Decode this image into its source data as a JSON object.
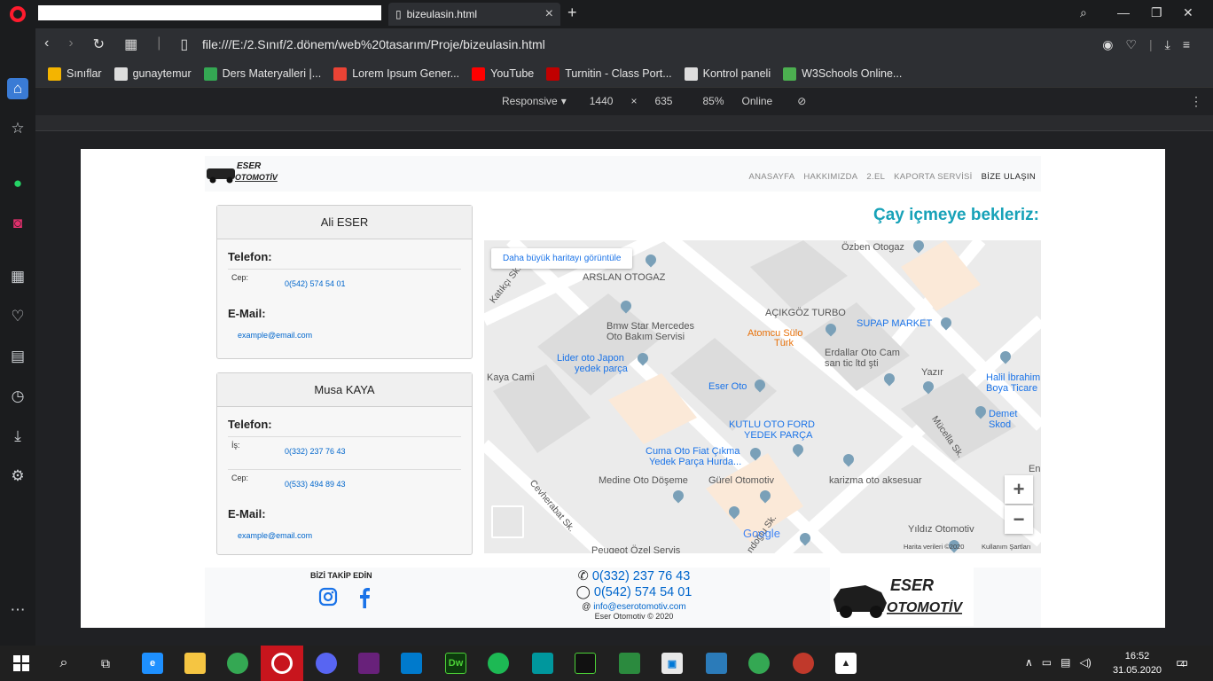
{
  "browser": {
    "tab_title": "bizeulasin.html",
    "address": "file:///E:/2.Sınıf/2.dönem/web%20tasarım/Proje/bizeulasin.html",
    "bookmarks": [
      {
        "label": "Sınıflar",
        "color": "#f4b400"
      },
      {
        "label": "gunaytemur",
        "color": "#dddddd"
      },
      {
        "label": "Ders Materyalleri |...",
        "color": "#34a853"
      },
      {
        "label": "Lorem Ipsum Gener...",
        "color": "#ea4335"
      },
      {
        "label": "YouTube",
        "color": "#ff0000"
      },
      {
        "label": "Turnitin - Class Port...",
        "color": "#c00000"
      },
      {
        "label": "Kontrol paneli",
        "color": "#dddddd"
      },
      {
        "label": "W3Schools Online...",
        "color": "#4caf50"
      }
    ],
    "devtools": {
      "mode": "Responsive",
      "width": "1440",
      "times": "×",
      "height": "635",
      "zoom": "85%",
      "throttle": "Online"
    }
  },
  "site": {
    "nav": {
      "items": [
        "ANASAYFA",
        "HAKKIMIZDA",
        "2.EL",
        "KAPORTA SERVİSİ",
        "BİZE ULAŞIN"
      ],
      "active": "BİZE ULAŞIN"
    },
    "logo_text_1": "ESER",
    "logo_text_2": "OTOMOTİV",
    "cards": [
      {
        "name": "Ali ESER",
        "phone_label": "Telefon:",
        "phones": [
          {
            "type": "Cep:",
            "number": "0(542) 574 54 01"
          }
        ],
        "mail_label": "E-Mail:",
        "mail": "example@email.com"
      },
      {
        "name": "Musa KAYA",
        "phone_label": "Telefon:",
        "phones": [
          {
            "type": "İş:",
            "number": "0(332) 237 76 43"
          },
          {
            "type": "Cep:",
            "number": "0(533) 494 89 43"
          }
        ],
        "mail_label": "E-Mail:",
        "mail": "example@email.com"
      }
    ],
    "map_title": "Çay içmeye bekleriz:",
    "map": {
      "larger_map": "Daha büyük haritayı görüntüle",
      "credits": "Harita verileri ©2020",
      "terms": "Kullanım Şartları",
      "google": "Google",
      "zoom_in": "+",
      "zoom_out": "−",
      "pois": [
        "Özben Otogaz",
        "ARSLAN OTOGAZ",
        "Bmw Star Mercedes",
        "Oto Bakım Servisi",
        "AÇIKGÖZ TURBO",
        "SUPAP MARKET",
        "Atomcu Sülo",
        "Türk",
        "Erdallar Oto Cam",
        "san tic ltd şti",
        "Lider oto Japon",
        "yedek parça",
        "Kaya Cami",
        "Eser Oto",
        "Yazır",
        "Halil İbrahim",
        "Boya Ticare",
        "Demet Skod",
        "KUTLU OTO FORD",
        "YEDEK PARÇA",
        "Cuma Oto Fiat Çıkma",
        "Yedek Parça Hurda...",
        "Medine Oto Döşeme",
        "Gürel Otomotiv",
        "karizma oto aksesuar",
        "Yıldız Otomotiv",
        "Peugeot Özel Servis",
        "En"
      ],
      "streets": [
        "Katıkçı Sk.",
        "Cevherabat Sk.",
        "Mücella Sk.",
        "ndoğlu Sk."
      ]
    },
    "footer": {
      "follow": "BİZİ TAKİP EDİN",
      "phone1": "0(332) 237 76 43",
      "phone2": "0(542) 574 54 01",
      "email": "info@eserotomotiv.com",
      "copyright": "Eser Otomotiv © 2020"
    }
  },
  "taskbar": {
    "time": "16:52",
    "date": "31.05.2020",
    "notifications": "4"
  }
}
